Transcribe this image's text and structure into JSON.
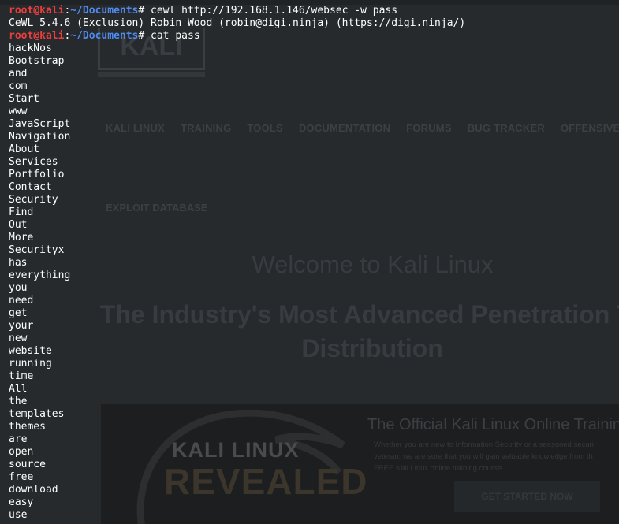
{
  "background_page": {
    "logo_text": "KALI",
    "nav_items": [
      "KALI LINUX",
      "TRAINING",
      "TOOLS",
      "DOCUMENTATION",
      "FORUMS",
      "BUG TRACKER",
      "OFFENSIVE SE"
    ],
    "subnav_item": "EXPLOIT DATABASE",
    "welcome": "Welcome to Kali Linux",
    "headline_line1": "The Industry's Most Advanced Penetration Te",
    "headline_line2": "Distribution",
    "banner": {
      "kali_linux": "KALI LINUX",
      "revealed": "REVEALED",
      "title": "The Official Kali Linux Online Trainin",
      "para_line1": "Whether you are new to Information Security or a seasoned securi",
      "para_line2": "veteran, we are sure that you will gain valuable knowledge from th",
      "para_line3": "FREE Kali Linux online training course.",
      "cta": "GET STARTED NOW"
    }
  },
  "terminal": {
    "prompt": {
      "user": "root@kali",
      "sep": ":",
      "path": "~/Documents",
      "hash": "# "
    },
    "commands": [
      "cewl http://192.168.1.146/websec -w pass",
      "cat pass"
    ],
    "output_line": "CeWL 5.4.6 (Exclusion) Robin Wood (robin@digi.ninja) (https://digi.ninja/)",
    "words": [
      "hackNos",
      "Bootstrap",
      "and",
      "com",
      "Start",
      "www",
      "JavaScript",
      "Navigation",
      "About",
      "Services",
      "Portfolio",
      "Contact",
      "Security",
      "Find",
      "Out",
      "More",
      "Securityx",
      "has",
      "everything",
      "you",
      "need",
      "get",
      "your",
      "new",
      "website",
      "running",
      "time",
      "All",
      "the",
      "templates",
      "themes",
      "are",
      "open",
      "source",
      "free",
      "download",
      "easy",
      "use"
    ]
  },
  "colors": {
    "prompt_user": "#e83e3e",
    "prompt_path": "#4f8bf0",
    "terminal_text": "#ffffff",
    "background": "#262a2d"
  }
}
